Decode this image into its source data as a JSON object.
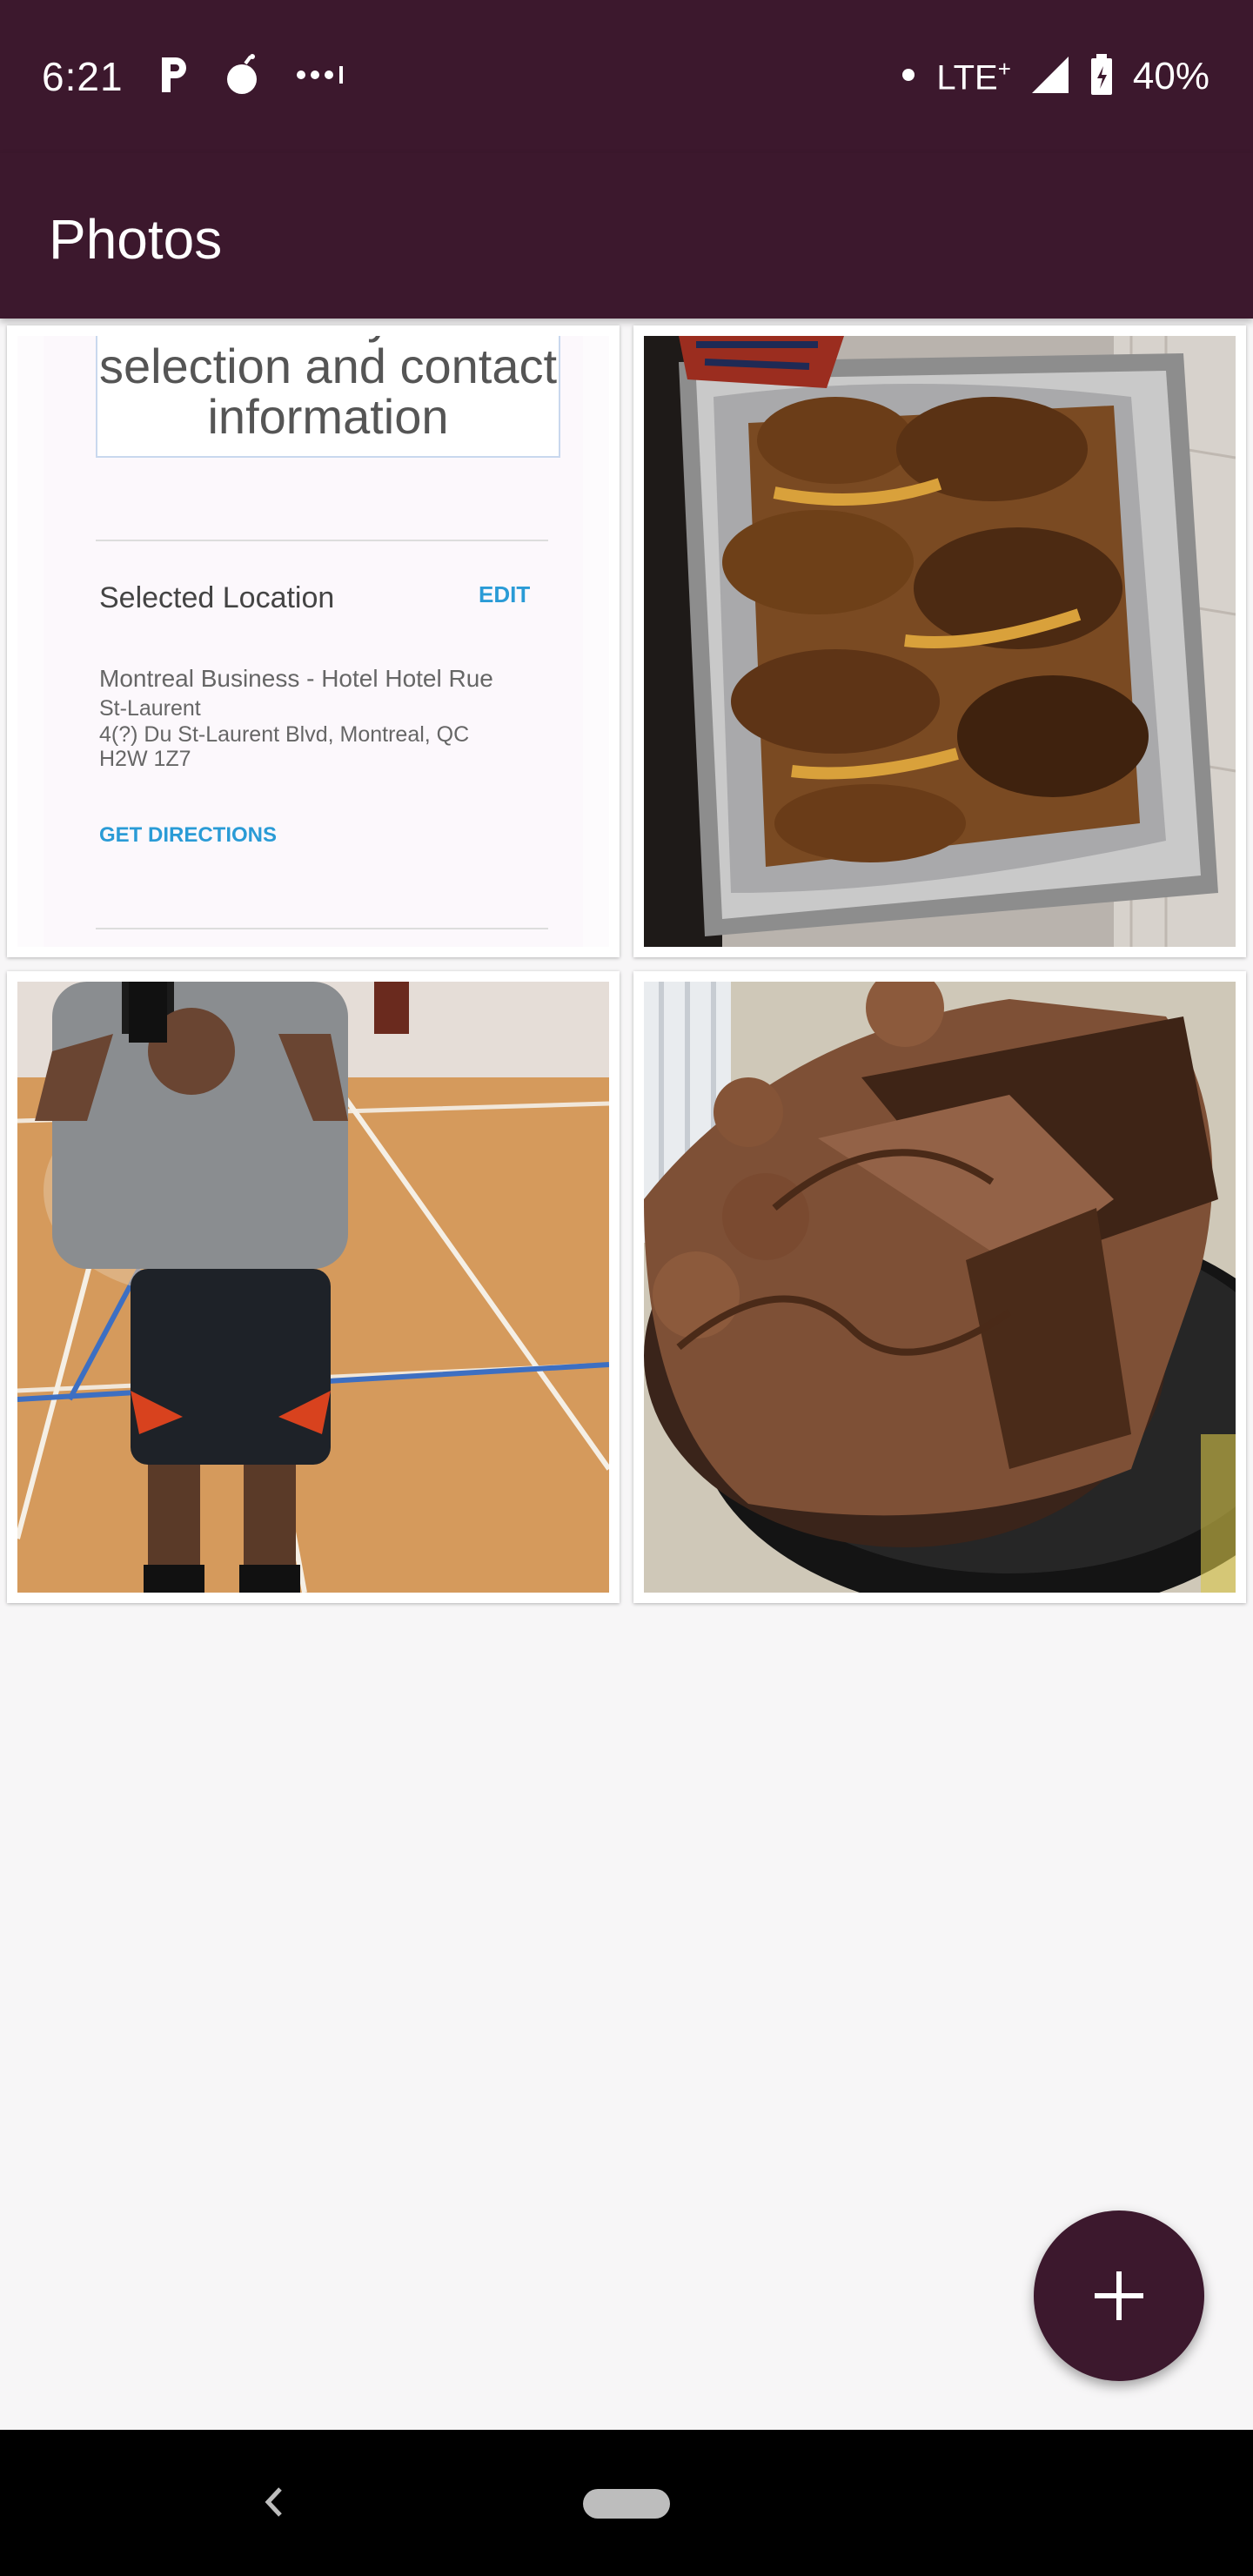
{
  "status_bar": {
    "time": "6:21",
    "network": "LTE",
    "battery": "40%"
  },
  "app_bar": {
    "title": "Photos"
  },
  "photos": [
    {
      "kind": "document-screenshot",
      "heading": "Review your selection and contact information",
      "selected_label": "Selected Location",
      "edit_label": "EDIT",
      "address_line1": "Montreal Business - Hotel Hotel Rue",
      "address_line2": "St-Laurent",
      "address_line3": "4(?) Du St-Laurent Blvd, Montreal, QC",
      "address_line4": "H2W 1Z7",
      "directions_label": "GET DIRECTIONS"
    },
    {
      "kind": "photo",
      "subject": "grilled chicken on foil tray"
    },
    {
      "kind": "photo",
      "subject": "mirror selfie on gym court"
    },
    {
      "kind": "photo",
      "subject": "chocolate cake"
    }
  ],
  "fab": {
    "icon": "plus-icon"
  },
  "nav_bar": {
    "back_icon": "back-icon",
    "home_icon": "home-pill-icon"
  },
  "colors": {
    "primary": "#3c182d",
    "background": "#f7f6f7",
    "accent_link": "#2a9bd6"
  }
}
